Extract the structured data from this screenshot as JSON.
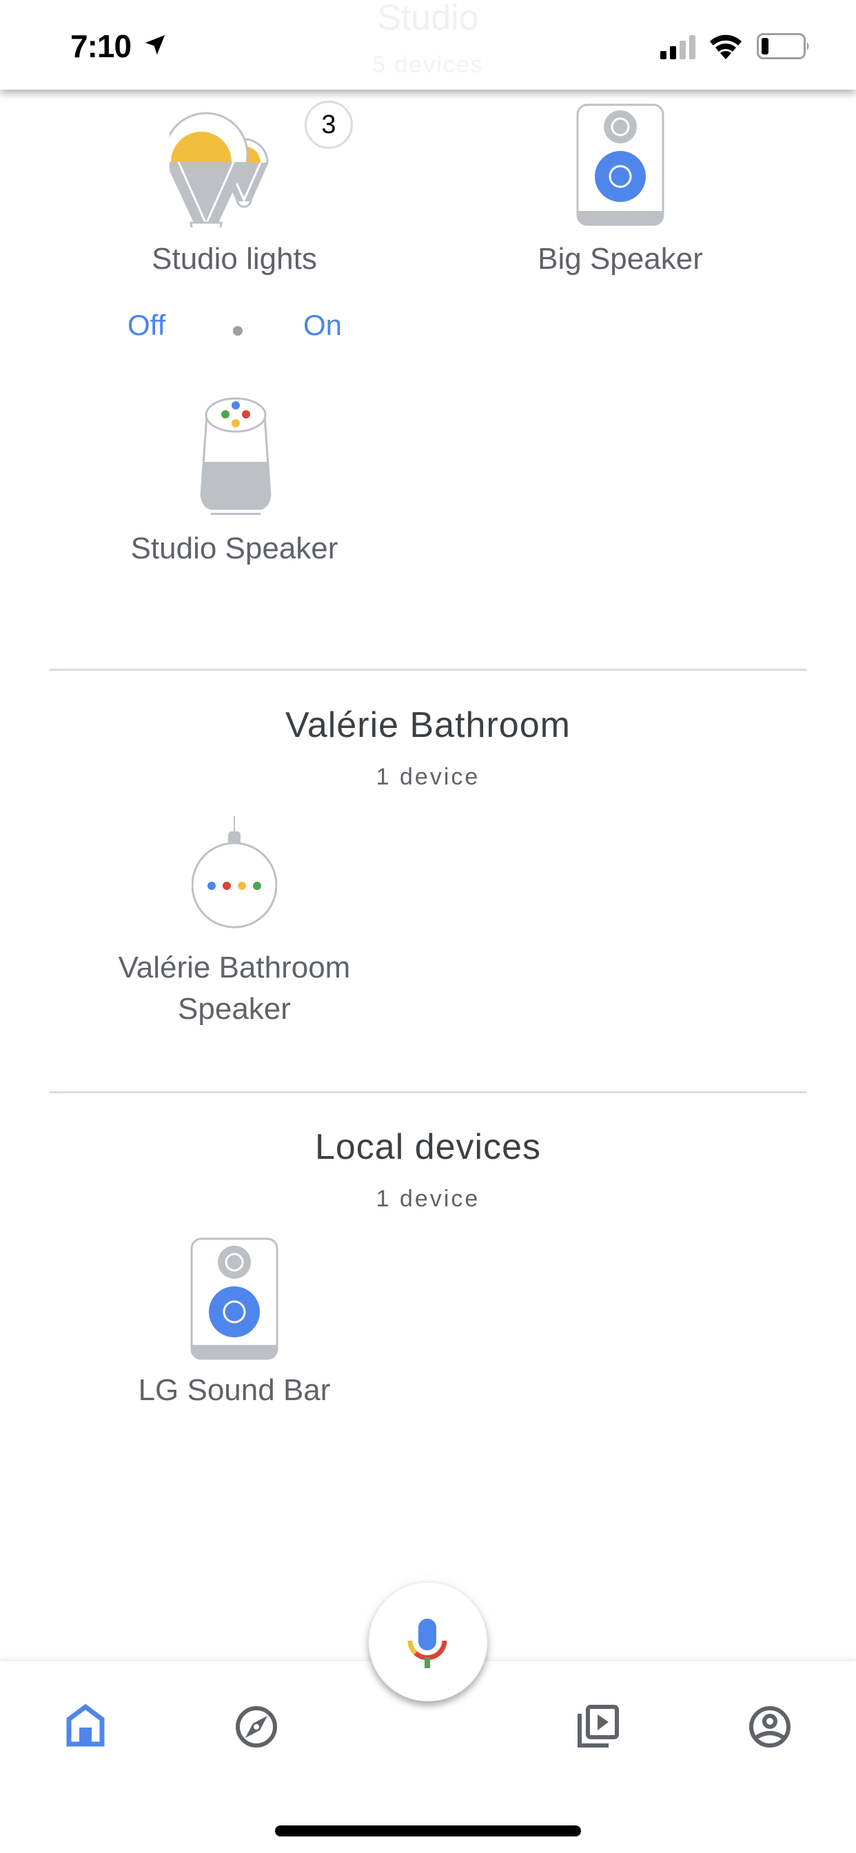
{
  "status_bar": {
    "time": "7:10",
    "location_icon": "location-arrow-icon",
    "signal_icon": "cellular-signal-icon",
    "wifi_icon": "wifi-icon",
    "battery_icon": "battery-low-icon"
  },
  "header": {
    "title": "Studio",
    "subtitle": "5 devices"
  },
  "rooms": [
    {
      "name": "Studio",
      "devices": [
        {
          "label": "Studio lights",
          "icon": "light-bulb-group-icon",
          "badge": "3",
          "controls": {
            "off_label": "Off",
            "on_label": "On"
          }
        },
        {
          "label": "Big Speaker",
          "icon": "speaker-icon"
        },
        {
          "label": "Studio Speaker",
          "icon": "google-home-speaker-icon"
        }
      ]
    },
    {
      "name": "Valérie Bathroom",
      "count": "1 device",
      "devices": [
        {
          "label_line1": "Valérie Bathroom",
          "label_line2": "Speaker",
          "icon": "google-home-mini-icon"
        }
      ]
    },
    {
      "name": "Local devices",
      "count": "1 device",
      "devices": [
        {
          "label": "LG Sound Bar",
          "icon": "speaker-icon"
        }
      ]
    }
  ],
  "bottom_nav": {
    "items": [
      {
        "name": "home",
        "icon": "home-icon",
        "active": true
      },
      {
        "name": "discover",
        "icon": "compass-icon",
        "active": false
      },
      {
        "name": "media",
        "icon": "media-library-icon",
        "active": false
      },
      {
        "name": "account",
        "icon": "account-circle-icon",
        "active": false
      }
    ],
    "mic_icon": "google-assistant-mic-icon"
  },
  "colors": {
    "accent_blue": "#4a84ee",
    "icon_gray": "#bdc1c6",
    "text_gray": "#5f6368",
    "title_dark": "#3c4043",
    "bulb_yellow": "#f1be3e",
    "google_red": "#db4437",
    "google_green": "#4ea652",
    "google_yellow": "#f4b400"
  }
}
